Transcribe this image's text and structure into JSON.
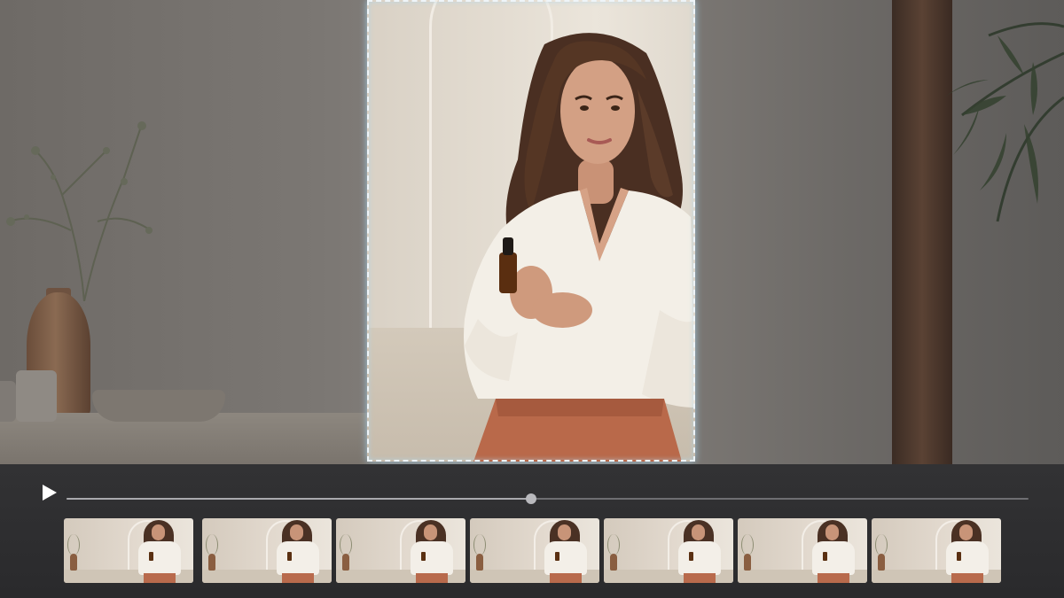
{
  "player": {
    "progress_fraction": 0.483,
    "state": "paused"
  },
  "icons": {
    "play": "play-icon"
  },
  "colors": {
    "crop_border": "#eef4f8",
    "crop_glow": "#aad7f0",
    "control_bar": "#2e2e30",
    "seek_track": "#6e6e72",
    "seek_handle": "#b9b9bd"
  },
  "filmstrip": {
    "frame_count": 7
  }
}
